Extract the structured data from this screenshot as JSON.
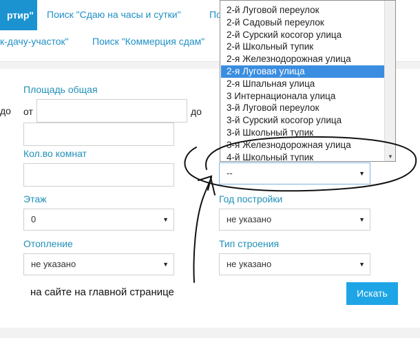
{
  "nav": {
    "active_tab": "ртир\"",
    "tab_rent_hourly": "Поиск \"Сдаю на часы и сутки\"",
    "tab_partial": "По",
    "tab_dacha": "к-дачу-участок\"",
    "tab_commerce": "Поиск \"Коммерция сдам\""
  },
  "form": {
    "area_label": "Площадь общая",
    "from_label": "от",
    "to_label": "до",
    "left_to_label": "до",
    "rooms_label": "Кол.во комнат",
    "floor_label": "Этаж",
    "floor_value": "0",
    "heating_label": "Отопление",
    "heating_value": "не указано",
    "street_value": "--",
    "year_label": "Год постройки",
    "year_value": "не указано",
    "building_type_label": "Тип строения",
    "building_type_value": "не указано",
    "search_button": "Искать"
  },
  "annotation": "на сайте на главной странице",
  "dropdown": {
    "items": [
      "2-й Луговой переулок",
      "2-й Садовый переулок",
      "2-й Сурский косогор улица",
      "2-й Школьный тупик",
      "2-я Железнодорожная улица",
      "2-я Луговая улица",
      "2-я Шпальная улица",
      "3 Интернационала улица",
      "3-й Луговой переулок",
      "3-й Сурский косогор улица",
      "3-й Школьный тупик",
      "3-я Железнодорожная улица",
      "4-й Школьный тупик"
    ],
    "selected_index": 5
  },
  "colors": {
    "accent": "#1b93d1",
    "link": "#1e8fc6",
    "selected_item": "#3a8de0",
    "button": "#1ea5e6"
  }
}
